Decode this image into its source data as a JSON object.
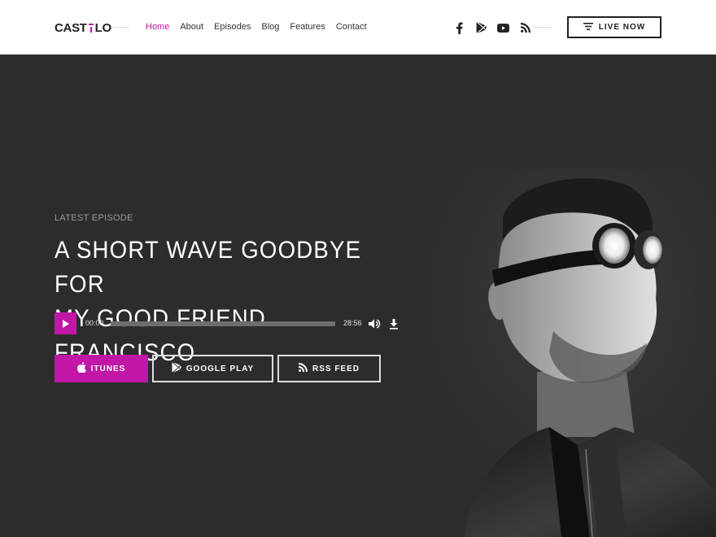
{
  "brand": {
    "logo_left": "CAST",
    "logo_right": "LO"
  },
  "nav": {
    "items": [
      {
        "label": "Home",
        "active": true
      },
      {
        "label": "About",
        "active": false
      },
      {
        "label": "Episodes",
        "active": false
      },
      {
        "label": "Blog",
        "active": false
      },
      {
        "label": "Features",
        "active": false
      },
      {
        "label": "Contact",
        "active": false
      }
    ]
  },
  "social": [
    "facebook-icon",
    "google-play-icon",
    "youtube-icon",
    "rss-icon"
  ],
  "live_button": {
    "label": "LIVE NOW",
    "icon": "menu-lines-icon"
  },
  "hero": {
    "eyebrow": "LATEST EPISODE",
    "title_line1": "A SHORT WAVE GOODBYE FOR",
    "title_line2": "MY GOOD FRIEND FRANCISCO"
  },
  "player": {
    "current_time": "00:00",
    "duration": "28:56",
    "progress": 0
  },
  "store_buttons": {
    "itunes": "ITUNES",
    "google_play": "GOOGLE PLAY",
    "rss": "RSS FEED"
  },
  "colors": {
    "accent": "#c216a7",
    "background": "#2c2c2c",
    "header": "#ffffff"
  }
}
